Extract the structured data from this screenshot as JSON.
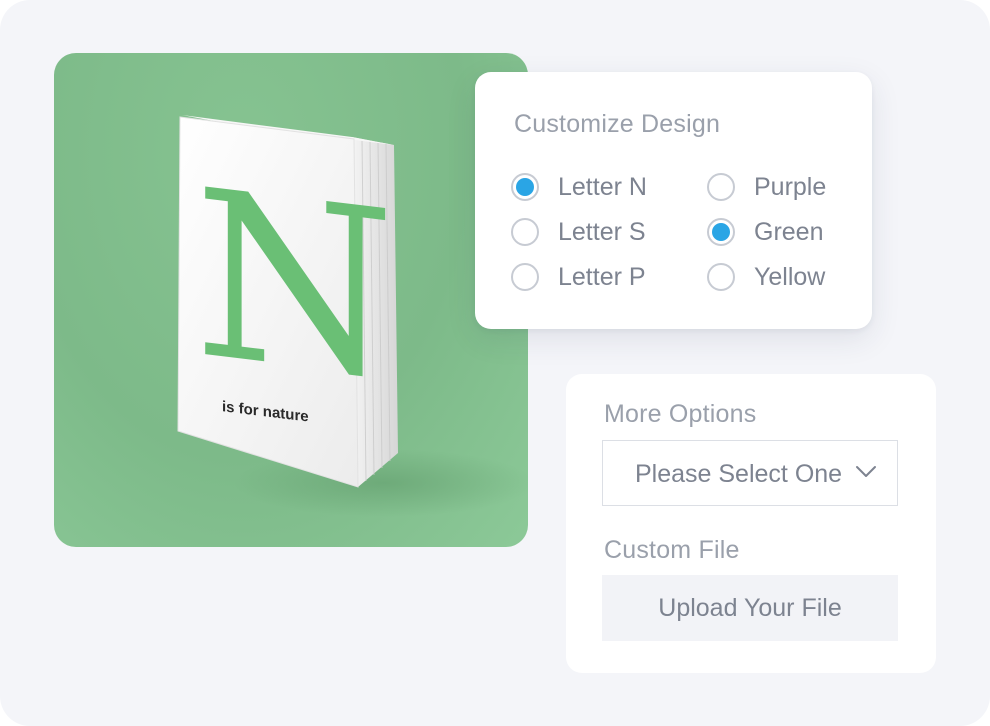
{
  "product": {
    "cover_letter": "N",
    "cover_tagline": "is for nature",
    "accent_color": "#6abf75"
  },
  "customize": {
    "title": "Customize Design",
    "letters": [
      {
        "label": "Letter N",
        "checked": true
      },
      {
        "label": "Letter S",
        "checked": false
      },
      {
        "label": "Letter P",
        "checked": false
      }
    ],
    "colors": [
      {
        "label": "Purple",
        "checked": false
      },
      {
        "label": "Green",
        "checked": true
      },
      {
        "label": "Yellow",
        "checked": false
      }
    ],
    "selected_color": "#2aa5e5"
  },
  "more_options": {
    "title": "More Options",
    "select_value": "Please Select One",
    "select_icon": "chevron-down-icon"
  },
  "custom_file": {
    "title": "Custom File",
    "upload_label": "Upload Your File"
  }
}
